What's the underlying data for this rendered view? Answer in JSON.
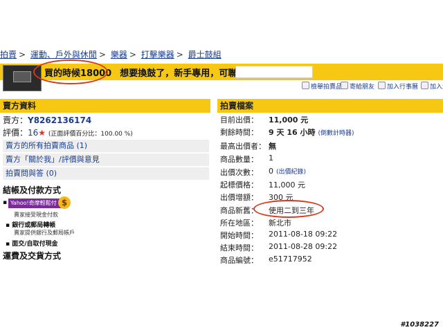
{
  "breadcrumb": [
    "拍賣",
    "運動、戶外與休閒",
    "樂器",
    "打擊樂器",
    "爵士鼓組"
  ],
  "listing": {
    "title_price": "買的時候18000",
    "title_rest": "想要換鼓了，新手專用，可聯絡："
  },
  "toolbar": [
    "檢舉拍賣品",
    "寄給朋友",
    "加入行事曆",
    "加入追"
  ],
  "seller": {
    "header": "賣方資料",
    "seller_label": "賣方：",
    "seller_id": "Y8262136174",
    "rating_label": "評價：",
    "rating_value": "16",
    "rating_note": "(正面評價百分比：100.00 %)",
    "links": [
      "賣方的所有拍賣商品 (1)",
      "賣方「關於我」/評價與意見",
      "拍賣問與答 (0)"
    ]
  },
  "payment": {
    "title": "結帳及付款方式",
    "yahoo_badge": "Yahoo!奇摩輕鬆付",
    "yahoo_sub": "賣家接受現金付款",
    "bank": "銀行或郵局轉帳",
    "bank_sub": "賣家提供銀行及郵局帳戶",
    "face": "面交/自取付現金",
    "shipping_title": "運費及交貨方式"
  },
  "auction": {
    "header": "拍賣檔案",
    "rows": [
      {
        "label": "目前出價：",
        "value": "11,000 元",
        "bold": true
      },
      {
        "label": "剩餘時間：",
        "value": "9 天 16 小時",
        "link": "(倒數計時器)",
        "bold": true
      },
      {
        "label": "最高出價者：",
        "value": "無",
        "bold": true
      },
      {
        "label": "商品數量：",
        "value": "1"
      },
      {
        "label": "出價次數：",
        "value": "0",
        "link": "(出價紀錄)"
      },
      {
        "label": "起標價格：",
        "value": "11,000 元"
      },
      {
        "label": "出價增額：",
        "value": "300 元"
      },
      {
        "label": "商品新舊：",
        "value": "使用二到三年"
      },
      {
        "label": "所在地區：",
        "value": "新北市"
      },
      {
        "label": "開始時間：",
        "value": "2011-08-18 09:22"
      },
      {
        "label": "結束時間：",
        "value": "2011-08-28 09:22"
      },
      {
        "label": "商品編號：",
        "value": "e51717952"
      }
    ]
  },
  "watermark": "#1038227",
  "colors": {
    "header_yellow": "#f6c814",
    "annotation_red": "#d9391b",
    "link_blue": "#1a3c8f"
  }
}
